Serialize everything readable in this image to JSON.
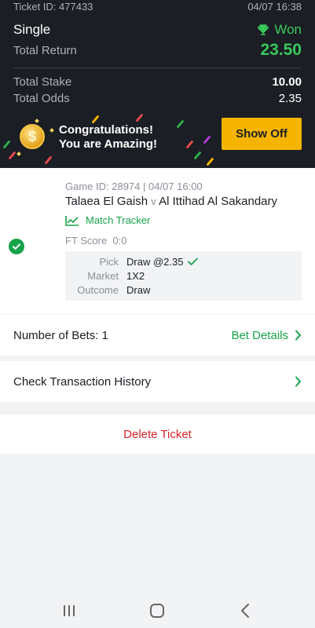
{
  "header": {
    "ticket_id": "Ticket ID: 477433",
    "datetime": "04/07 16:38",
    "bet_type": "Single",
    "status": "Won",
    "total_return_label": "Total Return",
    "total_return_value": "23.50",
    "total_stake_label": "Total Stake",
    "total_stake_value": "10.00",
    "total_odds_label": "Total Odds",
    "total_odds_value": "2.35"
  },
  "banner": {
    "line1": "Congratulations!",
    "line2": "You are Amazing!",
    "button_label": "Show Off",
    "coin_symbol": "$"
  },
  "bet": {
    "game_id": "Game ID: 28974 | 04/07 16:00",
    "home_team": "Talaea El Gaish",
    "vs": "v",
    "away_team": "Al Ittihad Al Sakandary",
    "match_tracker_label": "Match Tracker",
    "ft_score_label": "FT Score",
    "ft_score_value": "0:0",
    "pick_label": "Pick",
    "pick_value": "Draw @2.35",
    "market_label": "Market",
    "market_value": "1X2",
    "outcome_label": "Outcome",
    "outcome_value": "Draw"
  },
  "summary": {
    "number_of_bets": "Number of Bets: 1",
    "bet_details_label": "Bet Details",
    "transaction_history_label": "Check Transaction History",
    "delete_ticket_label": "Delete Ticket"
  },
  "icons": {
    "won": "trophy-icon",
    "tracker": "chart-line-icon",
    "won_check": "check-circle-icon",
    "chevron": "chevron-right-icon",
    "nav_recent": "recent-apps-icon",
    "nav_home": "home-icon",
    "nav_back": "back-icon"
  },
  "colors": {
    "header_bg": "#1b1e24",
    "win_green": "#38c95c",
    "accent_green": "#17a34a",
    "show_off_yellow": "#f4b400",
    "delete_red": "#d2232a"
  }
}
